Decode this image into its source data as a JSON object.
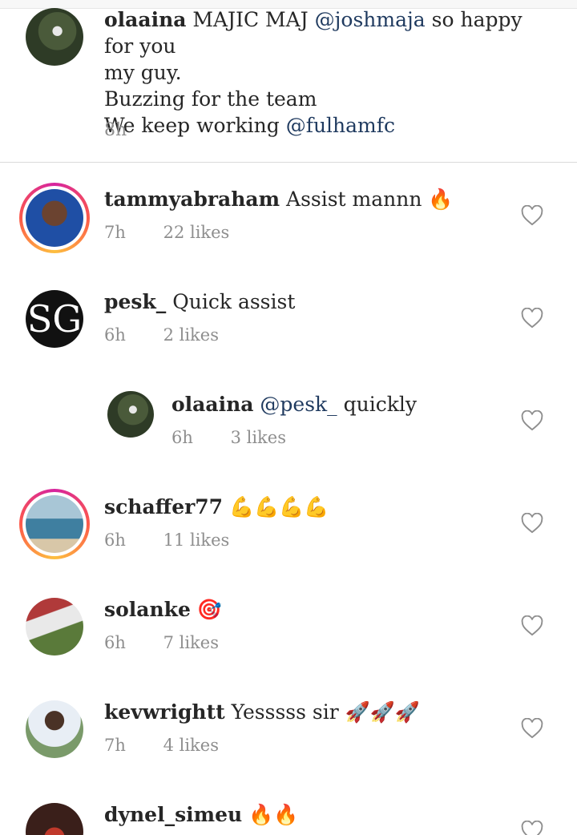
{
  "caption": {
    "username": "olaaina",
    "text_parts": [
      "MAJIC MAJ",
      "@joshmaja",
      "so happy for you",
      "my guy.",
      "Buzzing for the team",
      "We keep working",
      "@fulhamfc"
    ],
    "time": "8h"
  },
  "comments": [
    {
      "username": "tammyabraham",
      "text": "Assist mannn",
      "emoji": "🔥",
      "time": "7h",
      "likes": "22 likes"
    },
    {
      "username": "pesk_",
      "text": "Quick assist",
      "emoji": "",
      "time": "6h",
      "likes": "2 likes",
      "avatar_text": "SG"
    },
    {
      "username": "olaaina",
      "mention": "@pesk_",
      "text": "quickly",
      "time": "6h",
      "likes": "3 likes"
    },
    {
      "username": "schaffer77",
      "text": "",
      "emoji": "💪💪💪💪",
      "time": "6h",
      "likes": "11 likes"
    },
    {
      "username": "solanke",
      "text": "",
      "emoji": "🎯",
      "time": "6h",
      "likes": "7 likes"
    },
    {
      "username": "kevwrightt",
      "text": "Yesssss sir",
      "emoji": "🚀🚀🚀",
      "time": "7h",
      "likes": "4 likes"
    },
    {
      "username": "dynel_simeu",
      "text": "",
      "emoji": "🔥🔥",
      "time": "",
      "likes": ""
    }
  ],
  "icons": {
    "like": "heart-outline-icon"
  },
  "colors": {
    "mention": "#1f3a5f",
    "meta": "#8e8e8e",
    "story_ring": "#fd5949"
  }
}
